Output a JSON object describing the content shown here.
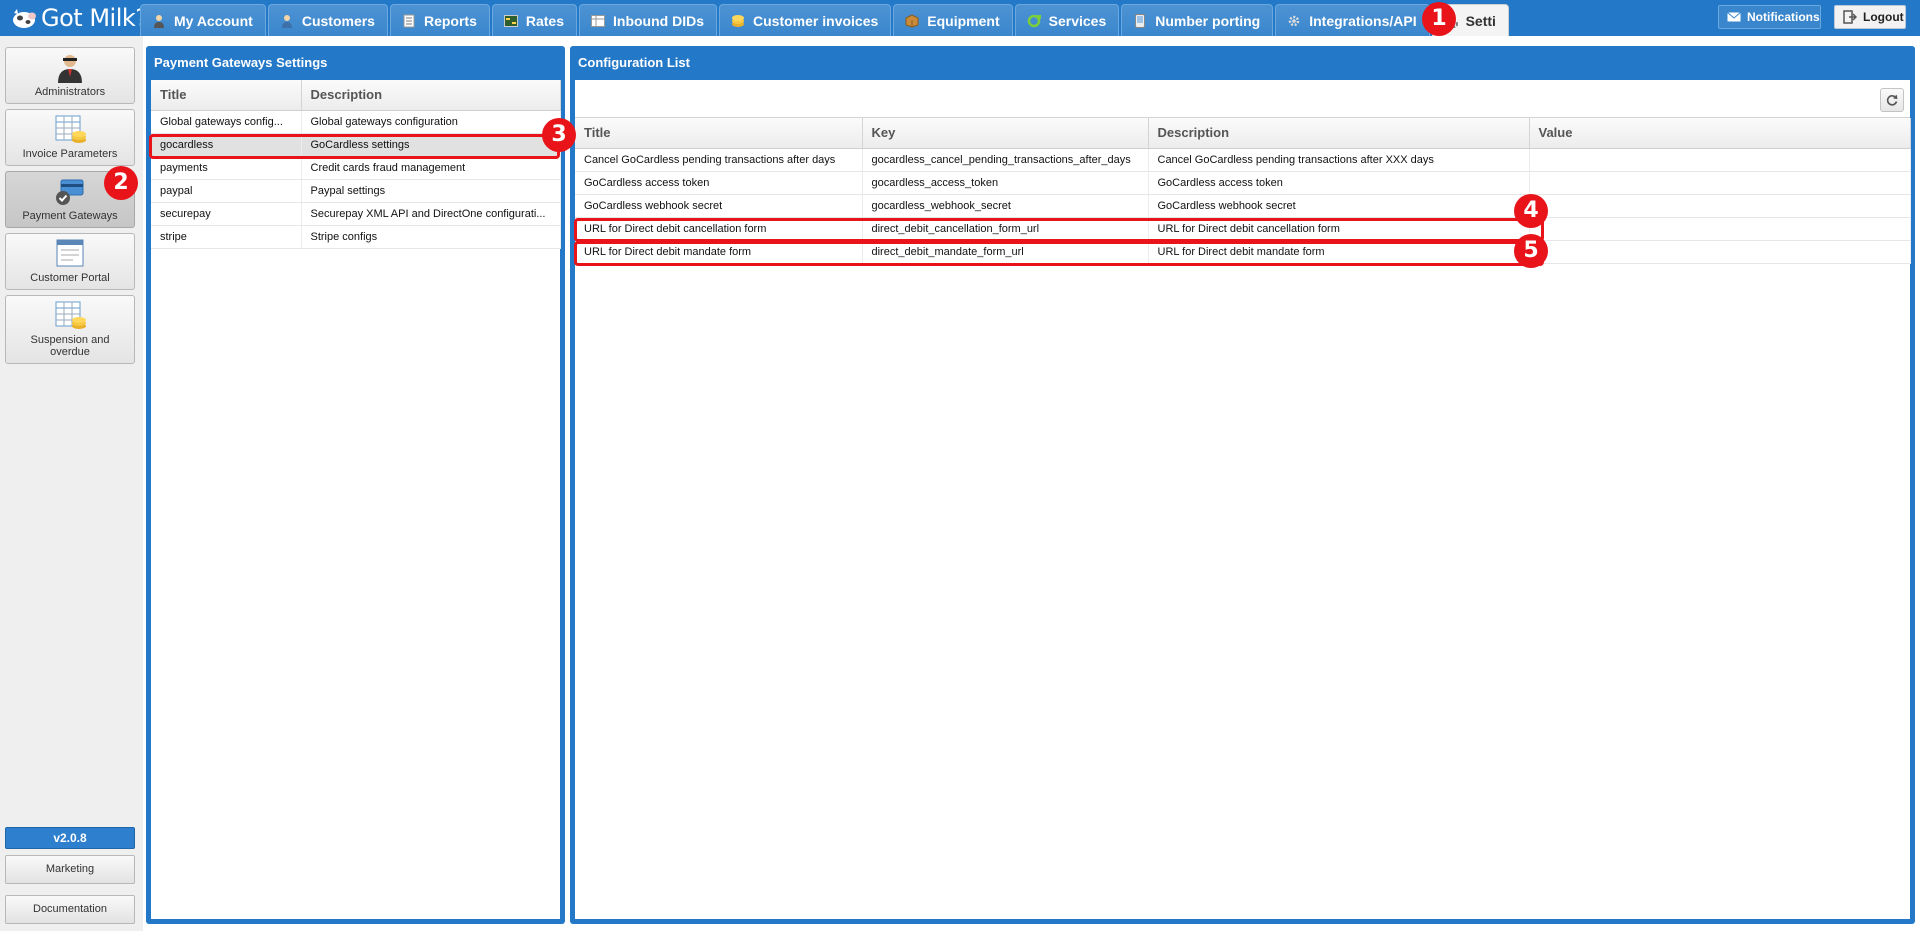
{
  "app": {
    "logo_text": "Got Milk?"
  },
  "nav": {
    "tabs": [
      {
        "label": "My Account",
        "icon": "user-icon"
      },
      {
        "label": "Customers",
        "icon": "customers-icon"
      },
      {
        "label": "Reports",
        "icon": "reports-icon"
      },
      {
        "label": "Rates",
        "icon": "rates-icon"
      },
      {
        "label": "Inbound DIDs",
        "icon": "dids-icon"
      },
      {
        "label": "Customer invoices",
        "icon": "invoices-icon"
      },
      {
        "label": "Equipment",
        "icon": "equipment-icon"
      },
      {
        "label": "Services",
        "icon": "services-icon"
      },
      {
        "label": "Number porting",
        "icon": "porting-icon"
      },
      {
        "label": "Integrations/API",
        "icon": "integrations-icon"
      },
      {
        "label": "Setti",
        "icon": "settings-gears-icon",
        "active": true
      }
    ],
    "notifications_label": "Notifications",
    "logout_label": "Logout"
  },
  "sidebar": {
    "items": [
      {
        "label": "Administrators",
        "icon": "administrator-icon"
      },
      {
        "label": "Invoice Parameters",
        "icon": "invoice-parameters-icon"
      },
      {
        "label": "Payment Gateways",
        "icon": "payment-gateways-icon",
        "active": true
      },
      {
        "label": "Customer Portal",
        "icon": "customer-portal-icon"
      },
      {
        "label": "Suspension and overdue",
        "icon": "suspension-icon"
      }
    ],
    "version": "v2.0.8",
    "marketing_label": "Marketing",
    "documentation_label": "Documentation"
  },
  "gateways_panel": {
    "title": "Payment Gateways Settings",
    "columns": [
      "Title",
      "Description"
    ],
    "rows": [
      {
        "title": "Global gateways config...",
        "description": "Global gateways configuration"
      },
      {
        "title": "gocardless",
        "description": "GoCardless settings",
        "selected": true
      },
      {
        "title": "payments",
        "description": "Credit cards fraud management"
      },
      {
        "title": "paypal",
        "description": "Paypal settings"
      },
      {
        "title": "securepay",
        "description": "Securepay XML API and DirectOne configurati..."
      },
      {
        "title": "stripe",
        "description": "Stripe configs"
      }
    ]
  },
  "config_panel": {
    "title": "Configuration List",
    "columns": [
      "Title",
      "Key",
      "Description",
      "Value"
    ],
    "rows": [
      {
        "title": "Cancel GoCardless pending transactions after days",
        "key": "gocardless_cancel_pending_transactions_after_days",
        "description": "Cancel GoCardless pending transactions after XXX days",
        "value": ""
      },
      {
        "title": "GoCardless access token",
        "key": "gocardless_access_token",
        "description": "GoCardless access token",
        "value": ""
      },
      {
        "title": "GoCardless webhook secret",
        "key": "gocardless_webhook_secret",
        "description": "GoCardless webhook secret",
        "value": ""
      },
      {
        "title": "URL for Direct debit cancellation form",
        "key": "direct_debit_cancellation_form_url",
        "description": "URL for Direct debit cancellation form",
        "value": ""
      },
      {
        "title": "URL for Direct debit mandate form",
        "key": "direct_debit_mandate_form_url",
        "description": "URL for Direct debit mandate form",
        "value": ""
      }
    ]
  },
  "annotations": {
    "badges": [
      "1",
      "2",
      "3",
      "4",
      "5"
    ],
    "color": "#e8141a"
  },
  "colors": {
    "primary_blue": "#2379c8",
    "selected_row": "#e1e1e1",
    "version_badge": "#2e7fcd"
  }
}
